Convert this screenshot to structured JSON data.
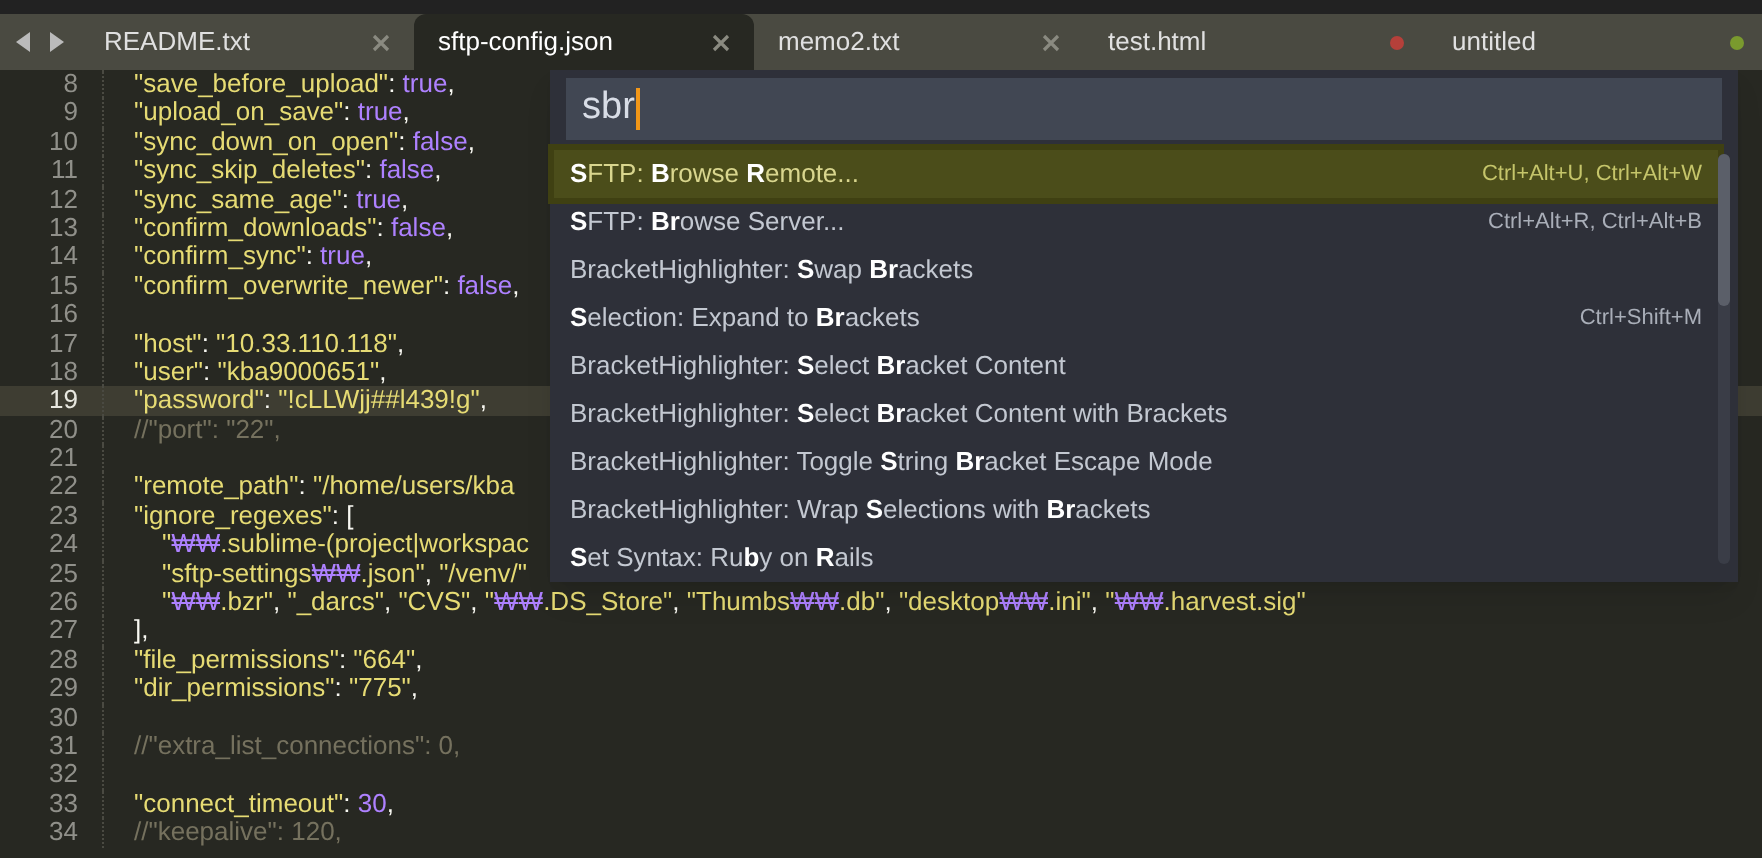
{
  "tabs": [
    {
      "label": "README.txt",
      "selected": false
    },
    {
      "label": "sftp-config.json",
      "selected": true
    },
    {
      "label": "memo2.txt",
      "selected": false
    },
    {
      "label": "test.html",
      "selected": false,
      "color": "#b5403a"
    },
    {
      "label": "untitled",
      "selected": false,
      "color": "#7a9a2e"
    }
  ],
  "editor": {
    "lines": [
      {
        "number": "8",
        "current": false,
        "segments": [
          {
            "kind": "str",
            "text": "\"save_before_upload\""
          },
          {
            "kind": "punc",
            "text": ": "
          },
          {
            "kind": "const",
            "text": "true"
          },
          {
            "kind": "punc",
            "text": ","
          }
        ]
      },
      {
        "number": "9",
        "current": false,
        "segments": [
          {
            "kind": "str",
            "text": "\"upload_on_save\""
          },
          {
            "kind": "punc",
            "text": ": "
          },
          {
            "kind": "const",
            "text": "true"
          },
          {
            "kind": "punc",
            "text": ","
          }
        ]
      },
      {
        "number": "10",
        "current": false,
        "segments": [
          {
            "kind": "str",
            "text": "\"sync_down_on_open\""
          },
          {
            "kind": "punc",
            "text": ": "
          },
          {
            "kind": "const",
            "text": "false"
          },
          {
            "kind": "punc",
            "text": ","
          }
        ]
      },
      {
        "number": "11",
        "current": false,
        "segments": [
          {
            "kind": "str",
            "text": "\"sync_skip_deletes\""
          },
          {
            "kind": "punc",
            "text": ": "
          },
          {
            "kind": "const",
            "text": "false"
          },
          {
            "kind": "punc",
            "text": ","
          }
        ]
      },
      {
        "number": "12",
        "current": false,
        "segments": [
          {
            "kind": "str",
            "text": "\"sync_same_age\""
          },
          {
            "kind": "punc",
            "text": ": "
          },
          {
            "kind": "const",
            "text": "true"
          },
          {
            "kind": "punc",
            "text": ","
          }
        ]
      },
      {
        "number": "13",
        "current": false,
        "segments": [
          {
            "kind": "str",
            "text": "\"confirm_downloads\""
          },
          {
            "kind": "punc",
            "text": ": "
          },
          {
            "kind": "const",
            "text": "false"
          },
          {
            "kind": "punc",
            "text": ","
          }
        ]
      },
      {
        "number": "14",
        "current": false,
        "segments": [
          {
            "kind": "str",
            "text": "\"confirm_sync\""
          },
          {
            "kind": "punc",
            "text": ": "
          },
          {
            "kind": "const",
            "text": "true"
          },
          {
            "kind": "punc",
            "text": ","
          }
        ]
      },
      {
        "number": "15",
        "current": false,
        "segments": [
          {
            "kind": "str",
            "text": "\"confirm_overwrite_newer\""
          },
          {
            "kind": "punc",
            "text": ": "
          },
          {
            "kind": "const",
            "text": "false"
          },
          {
            "kind": "punc",
            "text": ","
          }
        ]
      },
      {
        "number": "16",
        "current": false
      },
      {
        "number": "17",
        "current": false,
        "segments": [
          {
            "kind": "str",
            "text": "\"host\""
          },
          {
            "kind": "punc",
            "text": ": "
          },
          {
            "kind": "str",
            "text": "\"10.33.110.118\""
          },
          {
            "kind": "punc",
            "text": ","
          }
        ]
      },
      {
        "number": "18",
        "current": false,
        "segments": [
          {
            "kind": "str",
            "text": "\"user\""
          },
          {
            "kind": "punc",
            "text": ": "
          },
          {
            "kind": "str",
            "text": "\"kba9000651\""
          },
          {
            "kind": "punc",
            "text": ","
          }
        ]
      },
      {
        "number": "19",
        "current": true,
        "segments": [
          {
            "kind": "str",
            "text": "\"password\""
          },
          {
            "kind": "punc",
            "text": ": "
          },
          {
            "kind": "str",
            "text": "\"!cLLWjj##l439!g\""
          },
          {
            "kind": "punc",
            "text": ","
          }
        ]
      },
      {
        "number": "20",
        "current": false,
        "segments": [
          {
            "kind": "comment",
            "text": "//\"port\": \"22\","
          }
        ]
      },
      {
        "number": "21",
        "current": false
      },
      {
        "number": "22",
        "current": false,
        "segments": [
          {
            "kind": "str",
            "text": "\"remote_path\""
          },
          {
            "kind": "punc",
            "text": ": "
          },
          {
            "kind": "str",
            "text": "\"/home/users/kba"
          }
        ]
      },
      {
        "number": "23",
        "current": false,
        "segments": [
          {
            "kind": "str",
            "text": "\"ignore_regexes\""
          },
          {
            "kind": "punc",
            "text": ": ["
          }
        ],
        "children": [
          {
            "number": "24",
            "current": false,
            "segments": [
              {
                "kind": "str",
                "text": "\""
              },
              {
                "kind": "esc",
                "text": "₩₩"
              },
              {
                "kind": "str",
                "text": ".sublime-(project|workspac"
              }
            ]
          },
          {
            "number": "25",
            "current": false,
            "segments": [
              {
                "kind": "str",
                "text": "\"sftp-settings"
              },
              {
                "kind": "esc",
                "text": "₩₩"
              },
              {
                "kind": "str",
                "text": ".json\""
              },
              {
                "kind": "punc",
                "text": ", "
              },
              {
                "kind": "str",
                "text": "\"/venv/\""
              }
            ]
          },
          {
            "number": "26",
            "current": false,
            "segments": [
              {
                "kind": "str",
                "text": "\""
              },
              {
                "kind": "esc",
                "text": "₩₩"
              },
              {
                "kind": "str",
                "text": ".bzr\""
              },
              {
                "kind": "punc",
                "text": ", "
              },
              {
                "kind": "str",
                "text": "\"_darcs\""
              },
              {
                "kind": "punc",
                "text": ", "
              },
              {
                "kind": "str",
                "text": "\"CVS\""
              },
              {
                "kind": "punc",
                "text": ", "
              },
              {
                "kind": "str",
                "text": "\""
              },
              {
                "kind": "esc",
                "text": "₩₩"
              },
              {
                "kind": "str",
                "text": ".DS_Store\""
              },
              {
                "kind": "punc",
                "text": ", "
              },
              {
                "kind": "str",
                "text": "\"Thumbs"
              },
              {
                "kind": "esc",
                "text": "₩₩"
              },
              {
                "kind": "str",
                "text": ".db\""
              },
              {
                "kind": "punc",
                "text": ", "
              },
              {
                "kind": "str",
                "text": "\"desktop"
              },
              {
                "kind": "esc",
                "text": "₩₩"
              },
              {
                "kind": "str",
                "text": ".ini\""
              },
              {
                "kind": "punc",
                "text": ", "
              },
              {
                "kind": "str",
                "text": "\""
              },
              {
                "kind": "esc",
                "text": "₩₩"
              },
              {
                "kind": "str",
                "text": ".harvest.sig\""
              }
            ]
          }
        ]
      },
      {
        "number": "27",
        "current": false,
        "segments": [
          {
            "kind": "punc",
            "text": "],"
          }
        ]
      },
      {
        "number": "28",
        "current": false,
        "segments": [
          {
            "kind": "str",
            "text": "\"file_permissions\""
          },
          {
            "kind": "punc",
            "text": ": "
          },
          {
            "kind": "str",
            "text": "\"664\""
          },
          {
            "kind": "punc",
            "text": ","
          }
        ]
      },
      {
        "number": "29",
        "current": false,
        "segments": [
          {
            "kind": "str",
            "text": "\"dir_permissions\""
          },
          {
            "kind": "punc",
            "text": ": "
          },
          {
            "kind": "str",
            "text": "\"775\""
          },
          {
            "kind": "punc",
            "text": ","
          }
        ]
      },
      {
        "number": "30",
        "current": false
      },
      {
        "number": "31",
        "current": false,
        "segments": [
          {
            "kind": "comment",
            "text": "//\"extra_list_connections\": 0,"
          }
        ]
      },
      {
        "number": "32",
        "current": false
      },
      {
        "number": "33",
        "current": false,
        "segments": [
          {
            "kind": "str",
            "text": "\"connect_timeout\""
          },
          {
            "kind": "punc",
            "text": ": "
          },
          {
            "kind": "const",
            "text": "30"
          },
          {
            "kind": "punc",
            "text": ","
          }
        ]
      },
      {
        "number": "34",
        "current": false,
        "segments": [
          {
            "kind": "comment",
            "text": "//\"keepalive\": 120,"
          }
        ]
      }
    ]
  },
  "command_palette": {
    "query": "sbr",
    "items": [
      {
        "label": "**S**FTP: **B**rowse **R**emote...",
        "shortcut": "Ctrl+Alt+U, Ctrl+Alt+W",
        "selected": true
      },
      {
        "label": "**S**FTP: **Br**owse Server...",
        "shortcut": "Ctrl+Alt+R, Ctrl+Alt+B",
        "selected": false
      },
      {
        "label": "BracketHighlighter: **S**wap **Br**ackets",
        "selected": false
      },
      {
        "label": "**S**election: Expand to **Br**ackets",
        "shortcut": "Ctrl+Shift+M",
        "selected": false
      },
      {
        "label": "BracketHighlighter: **S**elect **Br**acket Content",
        "selected": false
      },
      {
        "label": "BracketHighlighter: **S**elect **Br**acket Content with Brackets",
        "selected": false
      },
      {
        "label": "BracketHighlighter: Toggle **S**tring **Br**acket Escape Mode",
        "selected": false
      },
      {
        "label": "BracketHighlighter: Wrap **S**elections with **Br**ackets",
        "selected": false
      },
      {
        "label": "**S**et Syntax: Ru**b**y on **R**ails",
        "selected": false
      }
    ]
  }
}
